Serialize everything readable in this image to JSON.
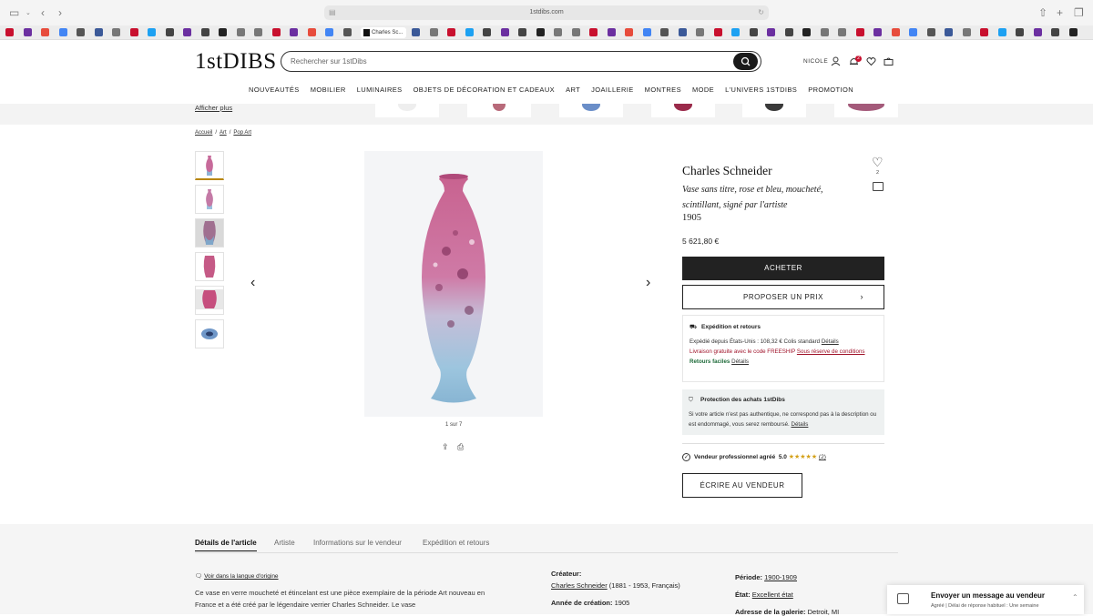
{
  "browser": {
    "url": "1stdibs.com",
    "active_tab": "Charles Sc..."
  },
  "header": {
    "logo": "1stDIBS",
    "search_placeholder": "Rechercher sur 1stDibs",
    "user": "NICOLE",
    "notification_count": "2"
  },
  "nav": [
    "NOUVEAUTÉS",
    "MOBILIER",
    "LUMINAIRES",
    "OBJETS DE DÉCORATION ET CADEAUX",
    "ART",
    "JOAILLERIE",
    "MONTRES",
    "MODE",
    "L'UNIVERS 1STDIBS",
    "PROMOTION"
  ],
  "strip": {
    "link": "Afficher plus"
  },
  "breadcrumb": [
    "Accueil",
    "Art",
    "Pop Art"
  ],
  "gallery": {
    "count_label": "1 sur 7"
  },
  "product": {
    "artist": "Charles Schneider",
    "title": "Vase sans titre, rose et bleu, moucheté, scintillant, signé par l'artiste",
    "year": "1905",
    "price": "5 621,80 €",
    "favorites": "2",
    "buy_label": "ACHETER",
    "offer_label": "PROPOSER UN PRIX"
  },
  "shipping": {
    "title": "Expédition et retours",
    "line1": "Expédié depuis États-Unis : 108,32 € Colis standard",
    "line1_link": "Détails",
    "line2": "Livraison gratuite avec le code FREESHIP",
    "line2_link": "Sous réserve de conditions",
    "returns": "Retours faciles",
    "returns_link": "Détails"
  },
  "protection": {
    "title": "Protection des achats 1stDibs",
    "text": "Si votre article n'est pas authentique, ne correspond pas à la description ou est endommagé, vous serez remboursé.",
    "link": "Détails"
  },
  "seller": {
    "label": "Vendeur professionnel agréé",
    "rating": "5.0",
    "stars": "★★★★★",
    "reviews": "(2)",
    "write_label": "ÉCRIRE AU VENDEUR"
  },
  "details_tabs": [
    "Détails de l'article",
    "Artiste",
    "Informations sur le vendeur",
    "Expédition et retours"
  ],
  "details": {
    "translate_link": "Voir dans la langue d'origine",
    "description": "Ce vase en verre moucheté et étincelant est une pièce exemplaire de la période Art nouveau en France et a été créé par le légendaire verrier Charles Schneider. Le vase",
    "creator_label": "Créateur:",
    "creator_value": "Charles Schneider",
    "creator_extra": "(1881 - 1953, Français)",
    "year_label": "Année de création:",
    "year_value": "1905",
    "period_label": "Période:",
    "period_value": "1900-1909",
    "state_label": "État:",
    "state_value": "Excellent état",
    "gallery_label": "Adresse de la galerie:",
    "gallery_value": "Detroit, MI"
  },
  "chat": {
    "title": "Envoyer un message au vendeur",
    "sub": "Agréé | Délai de réponse habituel : Une semaine"
  },
  "colors": {
    "buy_button": "#222222",
    "protection_bg": "#eef1f1",
    "promo_red": "#a0142b",
    "returns_green": "#1e6b3a",
    "stars": "#d4a017"
  }
}
